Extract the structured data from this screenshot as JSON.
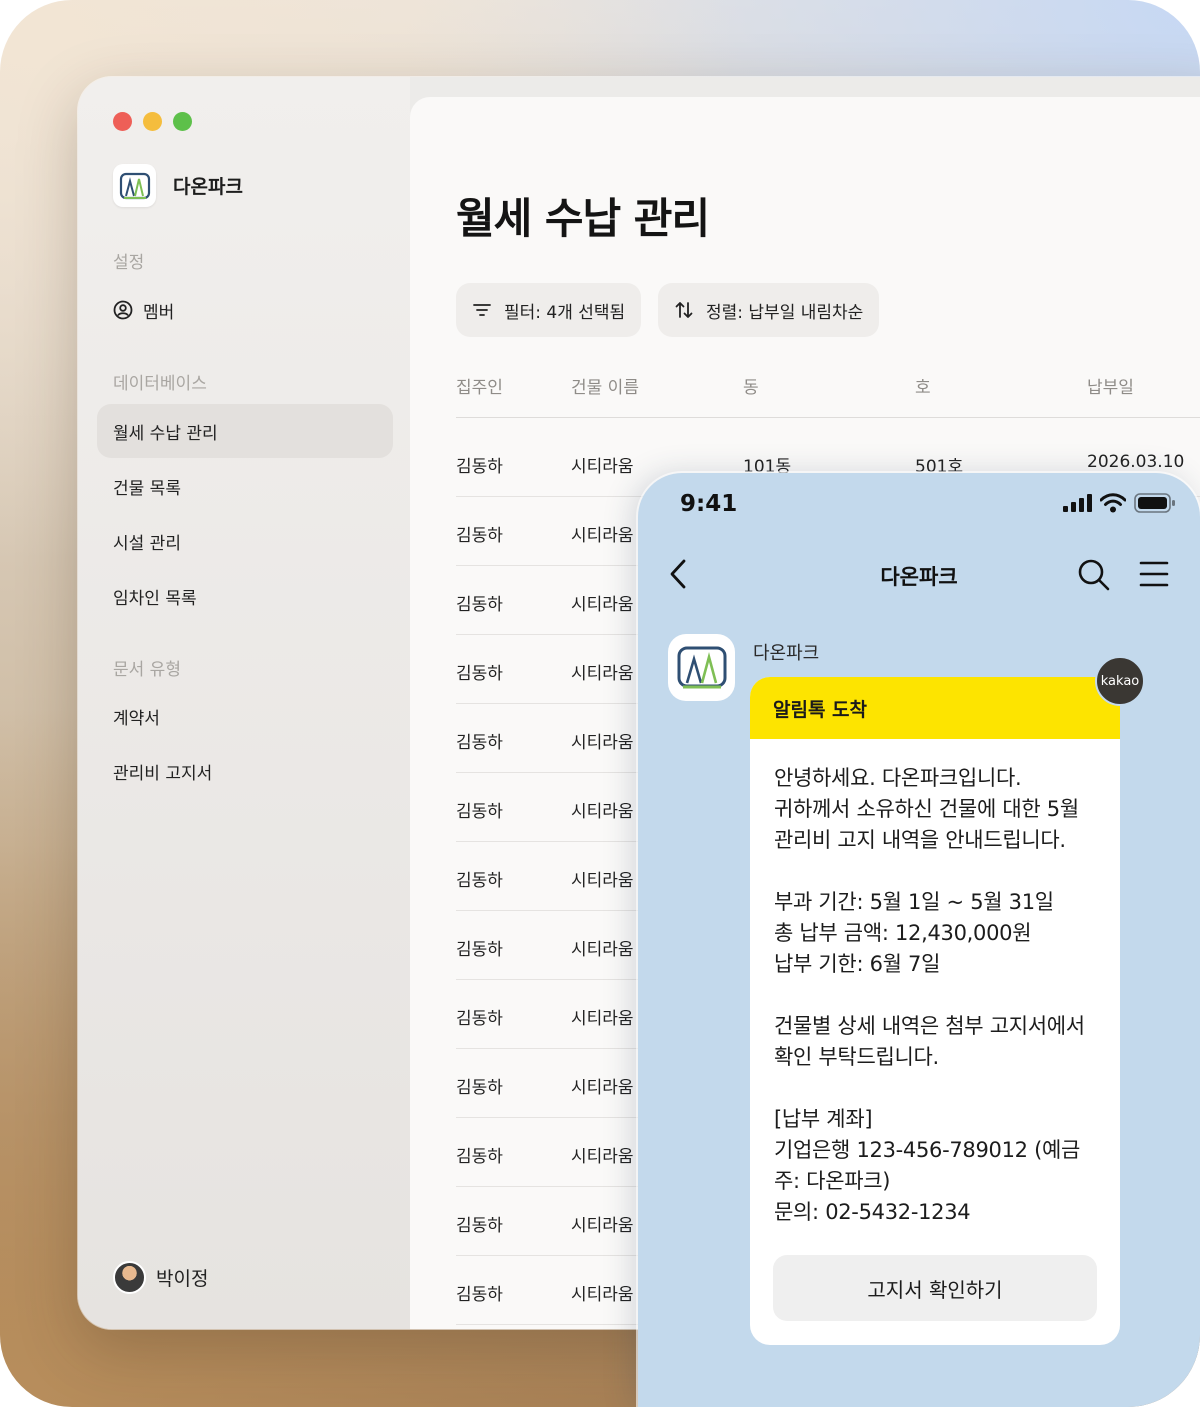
{
  "app": {
    "name": "다온파크"
  },
  "sidebar": {
    "sections": [
      {
        "label": "설정",
        "items": [
          {
            "label": "멤버"
          }
        ]
      },
      {
        "label": "데이터베이스",
        "items": [
          {
            "label": "월세 수납 관리",
            "active": true
          },
          {
            "label": "건물 목록"
          },
          {
            "label": "시설 관리"
          },
          {
            "label": "임차인 목록"
          }
        ]
      },
      {
        "label": "문서 유형",
        "items": [
          {
            "label": "계약서"
          },
          {
            "label": "관리비 고지서"
          }
        ]
      }
    ],
    "user": {
      "name": "박이정"
    }
  },
  "main": {
    "title": "월세 수납 관리",
    "filter_label": "필터: 4개 선택됨",
    "sort_label": "정렬: 납부일 내림차순",
    "columns": [
      "집주인",
      "건물 이름",
      "동",
      "호",
      "납부일"
    ],
    "rows": [
      [
        "김동하",
        "시티라움",
        "101동",
        "501호",
        "2026.03.10"
      ],
      [
        "김동하",
        "시티라움",
        "",
        "",
        ""
      ],
      [
        "김동하",
        "시티라움",
        "",
        "",
        ""
      ],
      [
        "김동하",
        "시티라움",
        "",
        "",
        ""
      ],
      [
        "김동하",
        "시티라움",
        "",
        "",
        ""
      ],
      [
        "김동하",
        "시티라움",
        "",
        "",
        ""
      ],
      [
        "김동하",
        "시티라움",
        "",
        "",
        ""
      ],
      [
        "김동하",
        "시티라움",
        "",
        "",
        ""
      ],
      [
        "김동하",
        "시티라움",
        "",
        "",
        ""
      ],
      [
        "김동하",
        "시티라움",
        "",
        "",
        ""
      ],
      [
        "김동하",
        "시티라움",
        "",
        "",
        ""
      ],
      [
        "김동하",
        "시티라움",
        "",
        "",
        ""
      ],
      [
        "김동하",
        "시티라움",
        "",
        "",
        ""
      ]
    ]
  },
  "phone": {
    "time": "9:41",
    "nav_title": "다온파크",
    "sender": "다온파크",
    "badge": "kakao",
    "message_header": "알림톡 도착",
    "message_body": "안녕하세요. 다온파크입니다.\n귀하께서 소유하신 건물에 대한 5월 관리비 고지 내역을 안내드립니다.\n\n부과 기간: 5월 1일 ~ 5월 31일\n총 납부 금액: 12,430,000원\n납부 기한: 6월 7일\n\n건물별 상세 내역은 첨부 고지서에서 확인 부탁드립니다.\n\n[납부 계좌]\n기업은행 123-456-789012 (예금주: 다온파크)\n문의: 02-5432-1234",
    "message_button": "고지서 확인하기"
  },
  "colors": {
    "kakao_yellow": "#fde400",
    "phone_bg": "#c3d9ec",
    "sidebar_active": "#e3e0dd",
    "logo_blue": "#2f4f73",
    "logo_green": "#7fbf55"
  },
  "icons": [
    "user-circle-icon",
    "filter-icon",
    "sort-icon",
    "back-chevron-icon",
    "search-icon",
    "menu-icon",
    "signal-icon",
    "wifi-icon",
    "battery-icon"
  ]
}
